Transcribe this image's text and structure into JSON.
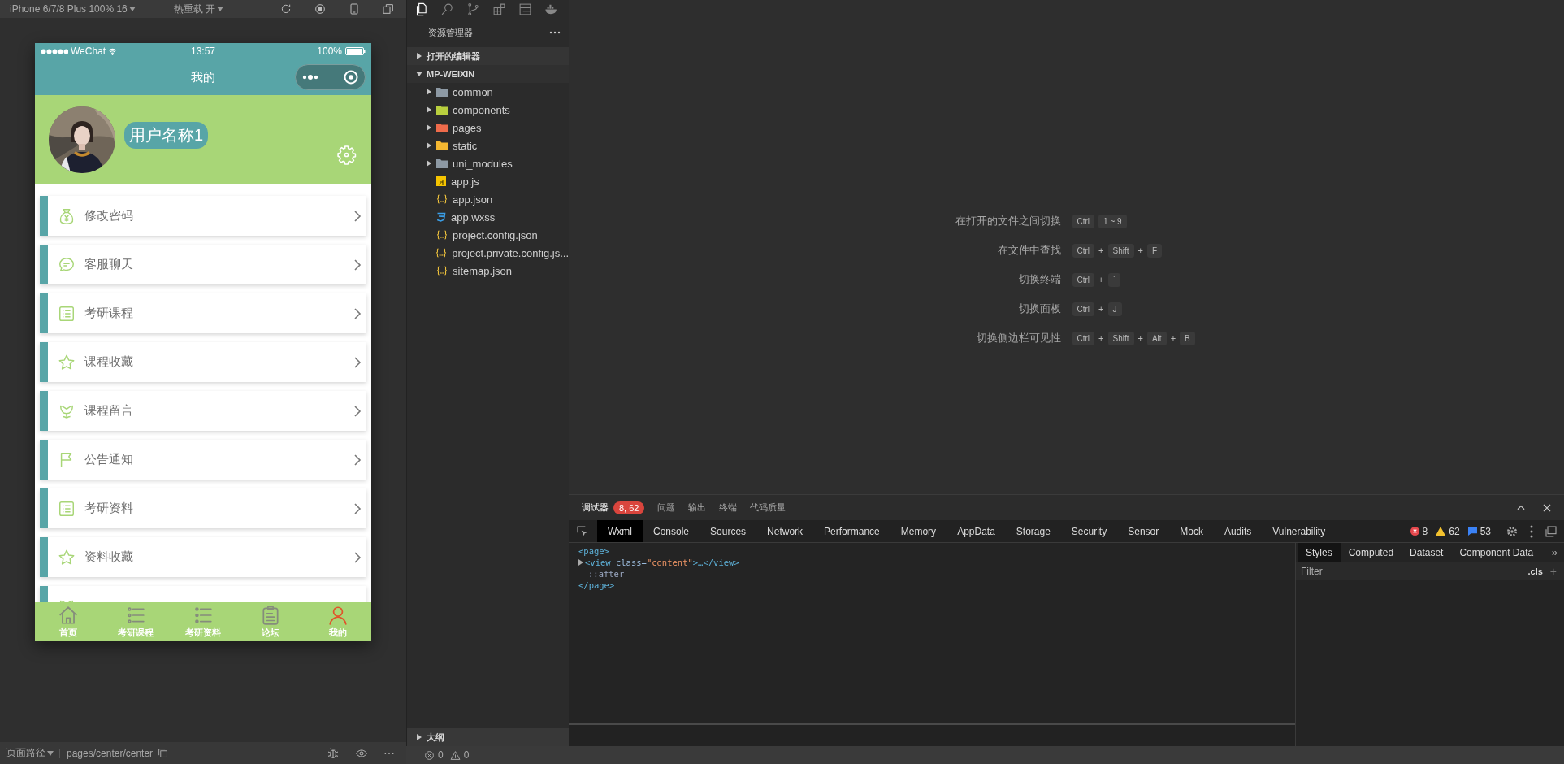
{
  "simulator": {
    "device": "iPhone 6/7/8 Plus 100% 16",
    "hot_reload": "热重载 开",
    "phone": {
      "status_bar": {
        "carrier": "WeChat",
        "time": "13:57",
        "battery": "100%"
      },
      "title": "我的",
      "profile": {
        "name": "用户名称1"
      },
      "menu": [
        {
          "label": "修改密码"
        },
        {
          "label": "客服聊天"
        },
        {
          "label": "考研课程"
        },
        {
          "label": "课程收藏"
        },
        {
          "label": "课程留言"
        },
        {
          "label": "公告通知"
        },
        {
          "label": "考研资料"
        },
        {
          "label": "资料收藏"
        }
      ],
      "tab_bar": [
        {
          "label": "首页",
          "selected": false
        },
        {
          "label": "考研课程",
          "selected": false
        },
        {
          "label": "考研资料",
          "selected": false
        },
        {
          "label": "论坛",
          "selected": false
        },
        {
          "label": "我的",
          "selected": true
        }
      ]
    },
    "path_bar": {
      "label": "页面路径",
      "path": "pages/center/center"
    }
  },
  "explorer": {
    "title": "资源管理器",
    "sections": [
      {
        "label": "打开的编辑器",
        "expanded": false
      },
      {
        "label": "MP-WEIXIN",
        "expanded": true,
        "children": [
          {
            "label": "common",
            "kind": "folder",
            "color": "#8d99a4",
            "expanded": false
          },
          {
            "label": "components",
            "kind": "folder",
            "color": "#b9cf3e",
            "expanded": false
          },
          {
            "label": "pages",
            "kind": "folder",
            "color": "#ef6b4b",
            "expanded": false
          },
          {
            "label": "static",
            "kind": "folder",
            "color": "#f4b731",
            "expanded": false
          },
          {
            "label": "uni_modules",
            "kind": "folder",
            "color": "#8d99a4",
            "expanded": false
          },
          {
            "label": "app.js",
            "kind": "js"
          },
          {
            "label": "app.json",
            "kind": "json"
          },
          {
            "label": "app.wxss",
            "kind": "css"
          },
          {
            "label": "project.config.json",
            "kind": "json"
          },
          {
            "label": "project.private.config.js...",
            "kind": "json"
          },
          {
            "label": "sitemap.json",
            "kind": "json"
          }
        ]
      }
    ],
    "outline": {
      "label": "大纲",
      "expanded": false
    }
  },
  "welcome": {
    "shortcuts": [
      {
        "label": "在打开的文件之间切换",
        "keys": [
          {
            "kind": "key",
            "text": "Ctrl"
          },
          {
            "kind": "key",
            "text": "1 ~ 9"
          }
        ]
      },
      {
        "label": "在文件中查找",
        "keys": [
          {
            "kind": "key",
            "text": "Ctrl"
          },
          {
            "kind": "plus",
            "text": "+"
          },
          {
            "kind": "key",
            "text": "Shift"
          },
          {
            "kind": "plus",
            "text": "+"
          },
          {
            "kind": "key",
            "text": "F"
          }
        ]
      },
      {
        "label": "切换终端",
        "keys": [
          {
            "kind": "key",
            "text": "Ctrl"
          },
          {
            "kind": "plus",
            "text": "+"
          },
          {
            "kind": "key",
            "text": "`"
          }
        ]
      },
      {
        "label": "切换面板",
        "keys": [
          {
            "kind": "key",
            "text": "Ctrl"
          },
          {
            "kind": "plus",
            "text": "+"
          },
          {
            "kind": "key",
            "text": "J"
          }
        ]
      },
      {
        "label": "切换侧边栏可见性",
        "keys": [
          {
            "kind": "key",
            "text": "Ctrl"
          },
          {
            "kind": "plus",
            "text": "+"
          },
          {
            "kind": "key",
            "text": "Shift"
          },
          {
            "kind": "plus",
            "text": "+"
          },
          {
            "kind": "key",
            "text": "Alt"
          },
          {
            "kind": "plus",
            "text": "+"
          },
          {
            "kind": "key",
            "text": "B"
          }
        ]
      }
    ]
  },
  "debugger": {
    "panel_tabs": [
      {
        "label": "调试器",
        "selected": true,
        "badge": "8, 62"
      },
      {
        "label": "问题",
        "selected": false
      },
      {
        "label": "输出",
        "selected": false
      },
      {
        "label": "终端",
        "selected": false
      },
      {
        "label": "代码质量",
        "selected": false
      }
    ],
    "tabs": [
      {
        "label": "Wxml",
        "selected": true
      },
      {
        "label": "Console",
        "selected": false
      },
      {
        "label": "Sources",
        "selected": false
      },
      {
        "label": "Network",
        "selected": false
      },
      {
        "label": "Performance",
        "selected": false
      },
      {
        "label": "Memory",
        "selected": false
      },
      {
        "label": "AppData",
        "selected": false
      },
      {
        "label": "Storage",
        "selected": false
      },
      {
        "label": "Security",
        "selected": false
      },
      {
        "label": "Sensor",
        "selected": false
      },
      {
        "label": "Mock",
        "selected": false
      },
      {
        "label": "Audits",
        "selected": false
      },
      {
        "label": "Vulnerability",
        "selected": false
      }
    ],
    "counts": {
      "errors": "8",
      "warnings": "62",
      "messages": "53"
    },
    "wxml": [
      {
        "kind": "plain",
        "parts": [
          {
            "kind": "tag",
            "text": "<page>"
          }
        ]
      },
      {
        "kind": "element",
        "expanded": false,
        "parts": [
          {
            "kind": "tag",
            "text": "<view"
          },
          {
            "kind": "attr",
            "text": " class="
          },
          {
            "kind": "value",
            "text": "\"content\""
          },
          {
            "kind": "tag",
            "text": ">…</view>"
          }
        ]
      },
      {
        "kind": "plain",
        "parts": [
          {
            "kind": "pseudo",
            "text": "::after"
          }
        ]
      },
      {
        "kind": "plain",
        "parts": [
          {
            "kind": "tag",
            "text": "</page>"
          }
        ]
      }
    ],
    "side_tabs": [
      {
        "label": "Styles",
        "selected": true
      },
      {
        "label": "Computed",
        "selected": false
      },
      {
        "label": "Dataset",
        "selected": false
      },
      {
        "label": "Component Data",
        "selected": false
      }
    ],
    "side_more": "»",
    "filter": {
      "placeholder": "Filter"
    },
    "cls": ".cls",
    "add": "+"
  },
  "status_bar": {
    "errors": "0",
    "warnings": "0"
  }
}
